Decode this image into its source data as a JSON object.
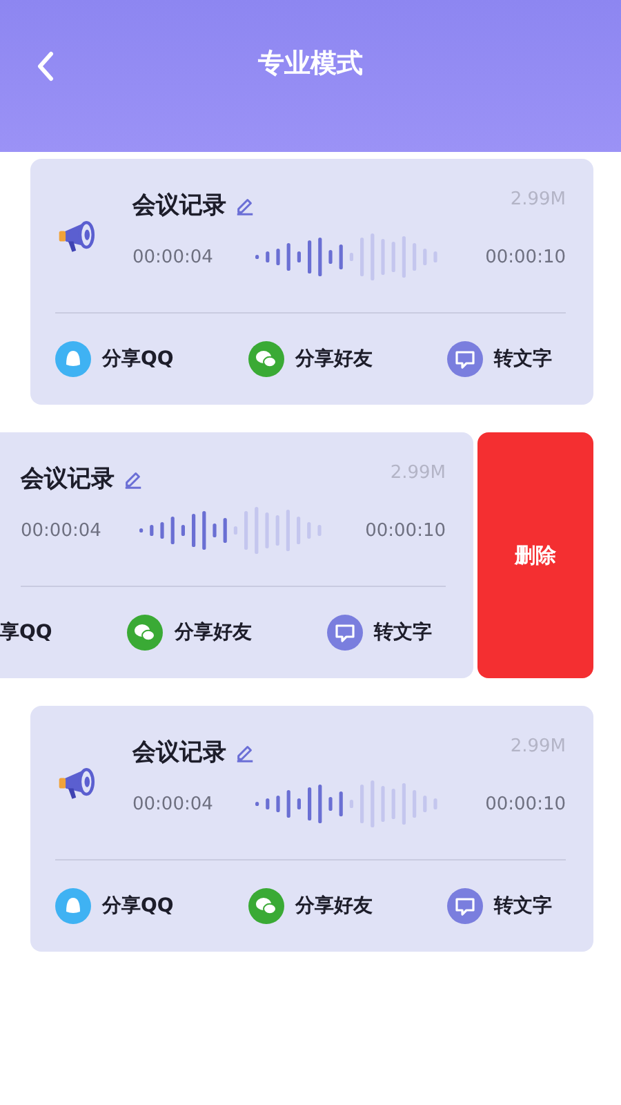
{
  "header": {
    "title": "专业模式"
  },
  "recordings": [
    {
      "kind": "normal",
      "title": "会议记录",
      "size": "2.99M",
      "start": "00:00:04",
      "end": "00:00:10",
      "shares": [
        {
          "kind": "qq",
          "label": "分享QQ"
        },
        {
          "kind": "wechat",
          "label": "分享好友"
        },
        {
          "kind": "text",
          "label": "转文字"
        }
      ]
    },
    {
      "kind": "swiped",
      "title": "会议记录",
      "size": "2.99M",
      "start": "00:00:04",
      "end": "00:00:10",
      "shares": [
        {
          "kind": "cut",
          "label": "享QQ"
        },
        {
          "kind": "wechat",
          "label": "分享好友"
        },
        {
          "kind": "text",
          "label": "转文字"
        }
      ],
      "delete_label": "删除"
    },
    {
      "kind": "normal",
      "title": "会议记录",
      "size": "2.99M",
      "start": "00:00:04",
      "end": "00:00:10",
      "shares": [
        {
          "kind": "qq",
          "label": "分享QQ"
        },
        {
          "kind": "wechat",
          "label": "分享好友"
        },
        {
          "kind": "text",
          "label": "转文字"
        }
      ]
    }
  ]
}
